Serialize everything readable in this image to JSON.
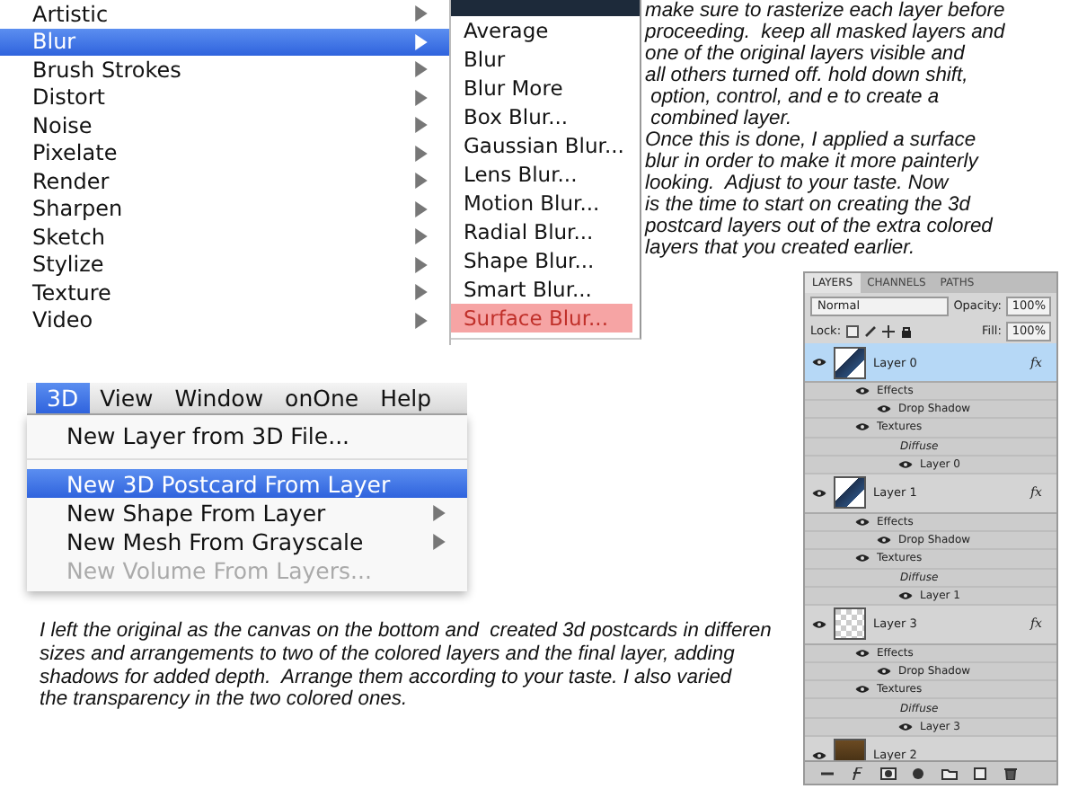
{
  "filter_menu": {
    "items": [
      {
        "label": "Artistic",
        "selected": false
      },
      {
        "label": "Blur",
        "selected": true
      },
      {
        "label": "Brush Strokes",
        "selected": false
      },
      {
        "label": "Distort",
        "selected": false
      },
      {
        "label": "Noise",
        "selected": false
      },
      {
        "label": "Pixelate",
        "selected": false
      },
      {
        "label": "Render",
        "selected": false
      },
      {
        "label": "Sharpen",
        "selected": false
      },
      {
        "label": "Sketch",
        "selected": false
      },
      {
        "label": "Stylize",
        "selected": false
      },
      {
        "label": "Texture",
        "selected": false
      },
      {
        "label": "Video",
        "selected": false
      }
    ]
  },
  "blur_submenu": {
    "items": [
      {
        "label": "Average",
        "selected": false
      },
      {
        "label": "Blur",
        "selected": false
      },
      {
        "label": "Blur More",
        "selected": false
      },
      {
        "label": "Box Blur...",
        "selected": false
      },
      {
        "label": "Gaussian Blur...",
        "selected": false
      },
      {
        "label": "Lens Blur...",
        "selected": false
      },
      {
        "label": "Motion Blur...",
        "selected": false
      },
      {
        "label": "Radial Blur...",
        "selected": false
      },
      {
        "label": "Shape Blur...",
        "selected": false
      },
      {
        "label": "Smart Blur...",
        "selected": false
      },
      {
        "label": "Surface Blur...",
        "selected": true
      }
    ]
  },
  "top_text": {
    "lines": [
      "make sure to rasterize each layer before",
      "proceeding.  keep all masked layers and",
      "one of the original layers visible and",
      "all others turned off. hold down shift,",
      " option, control, and e to create a",
      " combined layer.",
      "Once this is done, I applied a surface",
      "blur in order to make it more painterly",
      "looking.  Adjust to your taste. Now",
      "is the time to start on creating the 3d",
      "postcard layers out of the extra colored",
      "layers that you created earlier."
    ]
  },
  "menu_3d": {
    "menubar": [
      {
        "label": "3D",
        "selected": true
      },
      {
        "label": "View",
        "selected": false
      },
      {
        "label": "Window",
        "selected": false
      },
      {
        "label": "onOne",
        "selected": false
      },
      {
        "label": "Help",
        "selected": false
      }
    ],
    "items": [
      {
        "label": "New Layer from 3D File...",
        "selected": false,
        "disabled": false,
        "submenu": false,
        "separator_after": true
      },
      {
        "label": "New 3D Postcard From Layer",
        "selected": true,
        "disabled": false,
        "submenu": false,
        "separator_after": false
      },
      {
        "label": "New Shape From Layer",
        "selected": false,
        "disabled": false,
        "submenu": true,
        "separator_after": false
      },
      {
        "label": "New Mesh From Grayscale",
        "selected": false,
        "disabled": false,
        "submenu": true,
        "separator_after": false
      },
      {
        "label": "New Volume From Layers...",
        "selected": false,
        "disabled": true,
        "submenu": false,
        "separator_after": false
      }
    ]
  },
  "bottom_text": {
    "lines": [
      "I left the original as the canvas on the bottom and  created 3d postcards in differen",
      "sizes and arrangements to two of the colored layers and the final layer, adding",
      "shadows for added depth.  Arrange them according to your taste. I also varied",
      "the transparency in the two colored ones."
    ]
  },
  "layers_panel": {
    "tabs": [
      {
        "label": "LAYERS",
        "selected": true
      },
      {
        "label": "CHANNELS",
        "selected": false
      },
      {
        "label": "PATHS",
        "selected": false
      }
    ],
    "blend_mode": "Normal",
    "opacity_label": "Opacity:",
    "opacity": "100%",
    "lock_label": "Lock:",
    "fill_label": "Fill:",
    "fill": "100%",
    "layers": [
      {
        "name": "Layer 0",
        "selected": true,
        "fx": "fx",
        "kind": "art",
        "children": [
          {
            "label": "Effects",
            "kind": "group",
            "children": [
              {
                "label": "Drop Shadow",
                "kind": "effect"
              }
            ]
          },
          {
            "label": "Textures",
            "kind": "group",
            "children": [
              {
                "label": "Diffuse",
                "kind": "type",
                "children": [
                  {
                    "label": "Layer 0",
                    "kind": "effect"
                  }
                ]
              }
            ]
          }
        ]
      },
      {
        "name": "Layer 1",
        "selected": false,
        "fx": "fx",
        "kind": "art",
        "children": [
          {
            "label": "Effects",
            "kind": "group",
            "children": [
              {
                "label": "Drop Shadow",
                "kind": "effect"
              }
            ]
          },
          {
            "label": "Textures",
            "kind": "group",
            "children": [
              {
                "label": "Diffuse",
                "kind": "type",
                "children": [
                  {
                    "label": "Layer 1",
                    "kind": "effect"
                  }
                ]
              }
            ]
          }
        ]
      },
      {
        "name": "Layer 3",
        "selected": false,
        "fx": "fx",
        "kind": "transparent",
        "children": [
          {
            "label": "Effects",
            "kind": "group",
            "children": [
              {
                "label": "Drop Shadow",
                "kind": "effect"
              }
            ]
          },
          {
            "label": "Textures",
            "kind": "group",
            "children": [
              {
                "label": "Diffuse",
                "kind": "type",
                "children": [
                  {
                    "label": "Layer 3",
                    "kind": "effect"
                  }
                ]
              }
            ]
          }
        ]
      },
      {
        "name": "Layer 2",
        "selected": false,
        "kind": "photo"
      }
    ]
  }
}
